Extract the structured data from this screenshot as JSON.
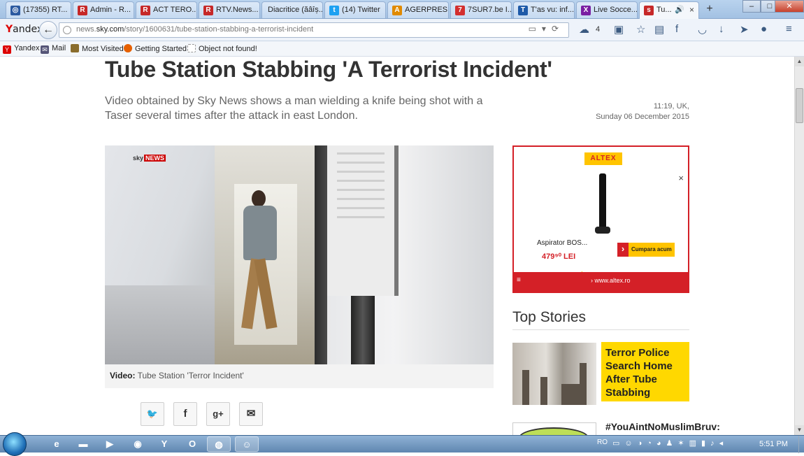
{
  "tabs": [
    {
      "label": "(17355) RT...",
      "icon": "rt-icon",
      "color": "#2c5aa0"
    },
    {
      "label": "Admin - R...",
      "icon": "r-icon",
      "color": "#c62828"
    },
    {
      "label": "ACT TERO...",
      "icon": "r-icon",
      "color": "#c62828"
    },
    {
      "label": "RTV.News...",
      "icon": "r-icon",
      "color": "#c62828"
    },
    {
      "label": "Diacritice (ăâîș...",
      "icon": "blank-icon",
      "color": "#d8d8d8"
    },
    {
      "label": "(14) Twitter",
      "icon": "twitter-icon",
      "color": "#1da1f2"
    },
    {
      "label": "AGERPRES...",
      "icon": "agerpres-icon",
      "color": "#e08a00"
    },
    {
      "label": "7SUR7.be I...",
      "icon": "7sur7-icon",
      "color": "#d32f2f"
    },
    {
      "label": "T'as vu: inf...",
      "icon": "tasvu-icon",
      "color": "#1e5aa8"
    },
    {
      "label": "Live Socce...",
      "icon": "livesoccer-icon",
      "color": "#7a1fa2"
    },
    {
      "label": "Tu...",
      "icon": "sky-news-icon",
      "color": "#c62828"
    }
  ],
  "nav": {
    "brand_prefix": "Y",
    "brand_rest": "andex",
    "url_prefix": "news.",
    "url_domain": "sky.com",
    "url_path": "/story/1600631/tube-station-stabbing-a-terrorist-incident",
    "weather_count": "4"
  },
  "bookmarks": [
    {
      "label": "Yandex",
      "icon": "yandex-icon",
      "color": "#d00"
    },
    {
      "label": "Mail",
      "icon": "mail-icon",
      "color": "#557"
    },
    {
      "label": "Most Visited",
      "icon": "folder-icon",
      "color": "#8a6d2d"
    },
    {
      "label": "Getting Started",
      "icon": "firefox-icon",
      "color": "#e66000"
    },
    {
      "label": "Object not found!",
      "icon": "blank-page-icon",
      "color": "#ffffff"
    }
  ],
  "article": {
    "headline": "Tube Station Stabbing 'A Terrorist Incident'",
    "standfirst": "Video obtained by Sky News shows a man wielding a knife being shot with a Taser several times after the attack in east London.",
    "time": "11:19, UK,",
    "date": "Sunday 06 December 2015",
    "video_logo_sky": "sky",
    "video_logo_news": "NEWS",
    "caption_label": "Video:",
    "caption_text": "Tube Station 'Terror Incident'"
  },
  "share": [
    {
      "label": "twitter",
      "glyph": "🐦",
      "icon": "twitter-icon"
    },
    {
      "label": "facebook",
      "glyph": "f",
      "icon": "facebook-icon"
    },
    {
      "label": "google plus",
      "glyph": "g+",
      "icon": "google-plus-icon"
    },
    {
      "label": "email",
      "glyph": "✉",
      "icon": "email-icon"
    }
  ],
  "ad": {
    "brand": "ALTEX",
    "product": "Aspirator BOS...",
    "price": "479⁹⁰ LEI",
    "cta": "Cumpara acum",
    "url": "› www.altex.ro",
    "close": "×"
  },
  "sidebar": {
    "heading": "Top Stories",
    "story1": "Terror Police Search Home After Tube Stabbing",
    "story2": "#YouAintNoMuslimBruv:"
  },
  "taskbar": {
    "lang": "RO",
    "clock": "5:51 PM"
  }
}
